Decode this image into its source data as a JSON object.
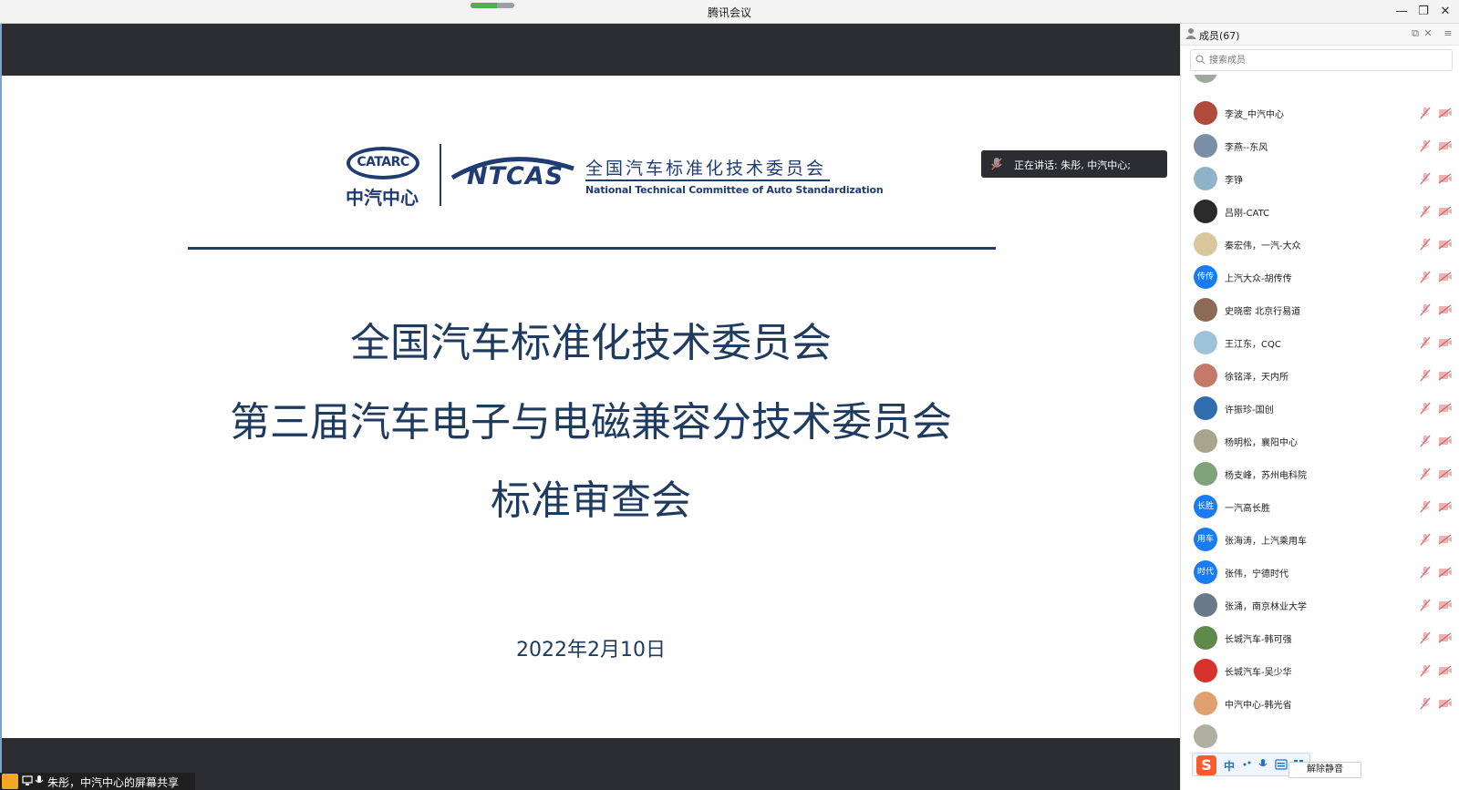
{
  "window": {
    "title": "腾讯会议"
  },
  "slide": {
    "logo_catarc": "CATARC",
    "logo_catarc_cn": "中汽中心",
    "logo_ntcas": "NTCAS",
    "org_cn": "全国汽车标准化技术委员会",
    "org_en": "National Technical Committee of Auto Standardization",
    "title_line1": "全国汽车标准化技术委员会",
    "title_line2": "第三届汽车电子与电磁兼容分技术委员会",
    "title_line3": "标准审查会",
    "date": "2022年2月10日",
    "colors": {
      "primary": "#1f3c73"
    }
  },
  "speaking": {
    "text": "正在讲话: 朱彤, 中汽中心;"
  },
  "share_bar": {
    "text": "朱彤，中汽中心的屏幕共享"
  },
  "panel": {
    "title": "成员(67)",
    "search_placeholder": "搜索成员",
    "members": [
      {
        "name": "李波_中汽中心",
        "avatar_color": "#b24a3c",
        "avatar_text": ""
      },
      {
        "name": "李燕--东风",
        "avatar_color": "#7a8fa8",
        "avatar_text": ""
      },
      {
        "name": "李铮",
        "avatar_color": "#8fb3c9",
        "avatar_text": ""
      },
      {
        "name": "吕刚-CATC",
        "avatar_color": "#2a2a2a",
        "avatar_text": ""
      },
      {
        "name": "秦宏伟，一汽-大众",
        "avatar_color": "#d9c89e",
        "avatar_text": ""
      },
      {
        "name": "上汽大众-胡传传",
        "avatar_color": "#1a7cf5",
        "avatar_text": "传传"
      },
      {
        "name": "史晓密 北京行易道",
        "avatar_color": "#8c6a55",
        "avatar_text": ""
      },
      {
        "name": "王江东，CQC",
        "avatar_color": "#9cc3d9",
        "avatar_text": ""
      },
      {
        "name": "徐铭泽，天内所",
        "avatar_color": "#c47a6a",
        "avatar_text": ""
      },
      {
        "name": "许振珍-国创",
        "avatar_color": "#2f6fb0",
        "avatar_text": ""
      },
      {
        "name": "杨明松，襄阳中心",
        "avatar_color": "#a9a48e",
        "avatar_text": ""
      },
      {
        "name": "杨支峰，苏州电科院",
        "avatar_color": "#7fa27a",
        "avatar_text": ""
      },
      {
        "name": "一汽高长胜",
        "avatar_color": "#1a7cf5",
        "avatar_text": "长胜"
      },
      {
        "name": "张海涛，上汽乘用车",
        "avatar_color": "#1a7cf5",
        "avatar_text": "用车"
      },
      {
        "name": "张伟，宁德时代",
        "avatar_color": "#1a7cf5",
        "avatar_text": "时代"
      },
      {
        "name": "张涌，南京林业大学",
        "avatar_color": "#6b7a8a",
        "avatar_text": ""
      },
      {
        "name": "长城汽车-韩可强",
        "avatar_color": "#5f8a4a",
        "avatar_text": ""
      },
      {
        "name": "长城汽车-吴少华",
        "avatar_color": "#d8332a",
        "avatar_text": ""
      },
      {
        "name": "中汽中心-韩光省",
        "avatar_color": "#e0a070",
        "avatar_text": ""
      }
    ],
    "unmute_all": "解除静音",
    "ime_mode": "中"
  }
}
